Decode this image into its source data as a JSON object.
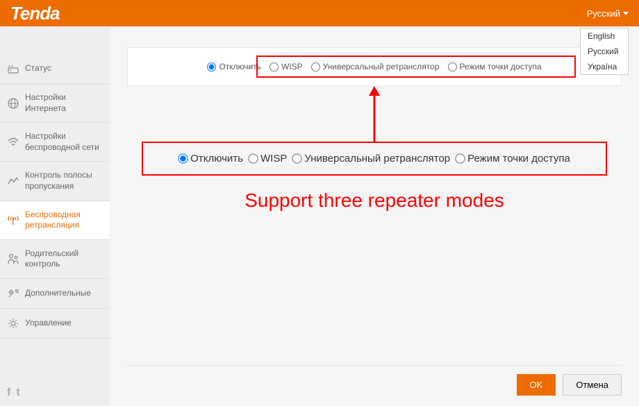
{
  "header": {
    "logo": "Tenda",
    "language": {
      "current": "Русский",
      "options": [
        "English",
        "Русский",
        "Україна"
      ]
    }
  },
  "sidebar": {
    "items": [
      {
        "label": "Статус"
      },
      {
        "label": "Настройки Интернета"
      },
      {
        "label": "Настройки беспроводной сети"
      },
      {
        "label": "Контроль полосы пропускания"
      },
      {
        "label": "Беспроводная ретрансляция"
      },
      {
        "label": "Родительский контроль"
      },
      {
        "label": "Дополнительные"
      },
      {
        "label": "Управление"
      }
    ]
  },
  "panel": {
    "modes": [
      {
        "label": "Отключить",
        "checked": true
      },
      {
        "label": "WISP",
        "checked": false
      },
      {
        "label": "Универсальный ретранслятор",
        "checked": false
      },
      {
        "label": "Режим точки доступа",
        "checked": false
      }
    ]
  },
  "zoom": {
    "modes": [
      {
        "label": "Отключить",
        "checked": true
      },
      {
        "label": "WISP",
        "checked": false
      },
      {
        "label": "Универсальный ретранслятор",
        "checked": false
      },
      {
        "label": "Режим точки доступа",
        "checked": false
      }
    ]
  },
  "annotation": {
    "caption": "Support three repeater modes"
  },
  "footer": {
    "ok": "OK",
    "cancel": "Отмена"
  },
  "social": {
    "f": "f",
    "t": "t"
  }
}
